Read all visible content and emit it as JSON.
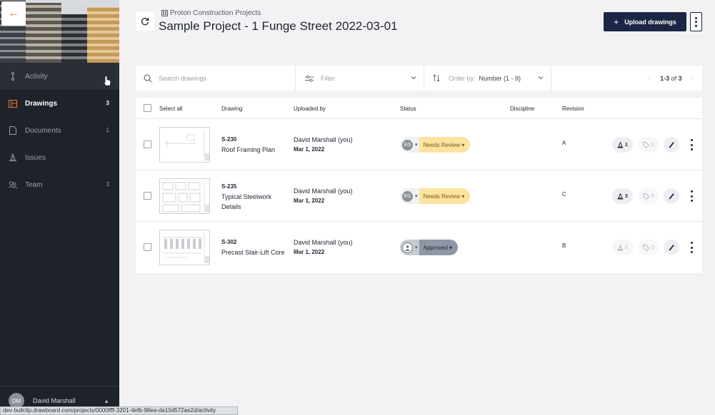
{
  "sidebar": {
    "items": [
      {
        "label": "Activity",
        "count": "",
        "icon": "activity-icon"
      },
      {
        "label": "Drawings",
        "count": "3",
        "icon": "drawings-icon"
      },
      {
        "label": "Documents",
        "count": "1",
        "icon": "documents-icon"
      },
      {
        "label": "Issues",
        "count": "",
        "icon": "issues-icon"
      },
      {
        "label": "Team",
        "count": "3",
        "icon": "team-icon"
      }
    ],
    "user": {
      "name": "David Marshall",
      "initials": "DM"
    }
  },
  "status_bar_url": "dev-bullclip.drawboard.com/projects/0000ffff-3201-4efb-98ea-da10d572ae2d/activity",
  "header": {
    "breadcrumb": "Proton Construction Projects",
    "title": "Sample Project - 1 Funge Street 2022-03-01",
    "upload_label": "Upload drawings"
  },
  "toolbar": {
    "search_placeholder": "Search drawings",
    "filter_label": "Filter",
    "order_label": "Order by:",
    "order_value": "Number (1 - 9)",
    "pager_range": "1-3",
    "pager_of": "of",
    "pager_total": "3"
  },
  "table": {
    "headers": {
      "select_all": "Select all",
      "drawing": "Drawing",
      "uploaded_by": "Uploaded by",
      "status": "Status",
      "discipline": "Discipline",
      "revision": "Revision"
    },
    "rows": [
      {
        "code": "S-230",
        "name": "Roof Framing Plan",
        "uploader": "David Marshall (you)",
        "date": "Mar 1, 2022",
        "assignee": "EG",
        "status": "Needs Review",
        "discipline": "",
        "revision": "A",
        "issues": "1",
        "tags": "0"
      },
      {
        "code": "S-235",
        "name": "Typical Steelwork Details",
        "uploader": "David Marshall (you)",
        "date": "Mar 1, 2022",
        "assignee": "EG",
        "status": "Needs Review",
        "discipline": "",
        "revision": "C",
        "issues": "3",
        "tags": "0"
      },
      {
        "code": "S-302",
        "name": "Precast Stair-Lift Core",
        "uploader": "David Marshall (you)",
        "date": "Mar 1, 2022",
        "assignee": "",
        "status": "Approved",
        "discipline": "",
        "revision": "B",
        "issues": "0",
        "tags": "0"
      }
    ]
  },
  "colors": {
    "sidebar_bg": "#1e2229",
    "accent_navy": "#1b2644",
    "back_arrow": "#e8793a",
    "needs_review": "#fbe3a0",
    "approved": "#8f97a6"
  }
}
